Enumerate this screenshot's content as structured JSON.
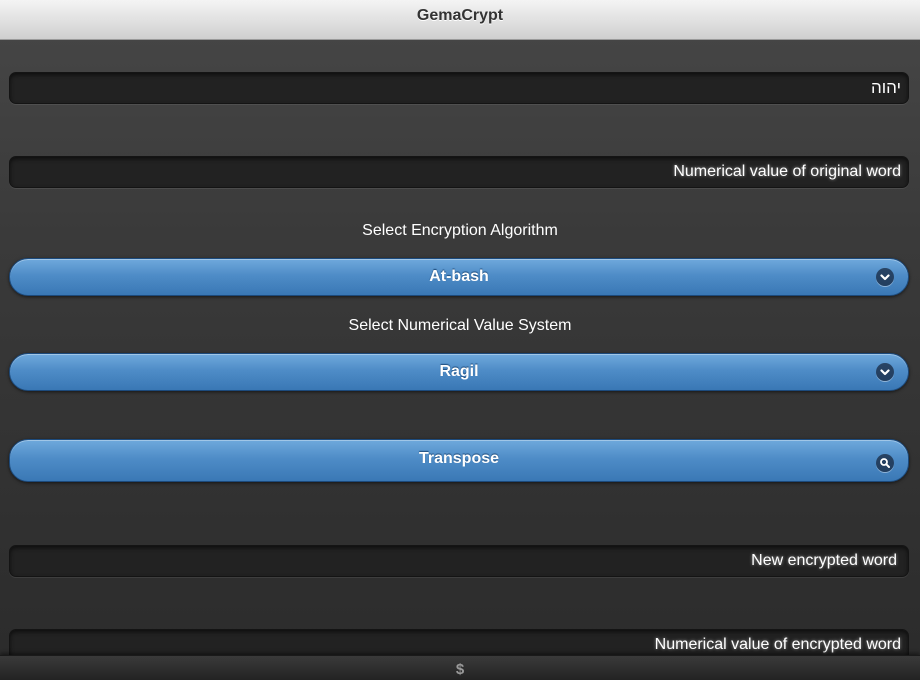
{
  "header": {
    "title": "GemaCrypt"
  },
  "original_word": {
    "value": "יהוה"
  },
  "original_numeric": {
    "placeholder": "Numerical value of original word"
  },
  "algorithm": {
    "label": "Select Encryption Algorithm",
    "selected": "At-bash",
    "icon": "chevron-down-icon"
  },
  "numeric_system": {
    "label": "Select Numerical Value System",
    "selected": "Ragil",
    "icon": "chevron-down-icon"
  },
  "transpose": {
    "label": "Transpose",
    "icon": "search-icon"
  },
  "encrypted_word": {
    "placeholder": "New encrypted word"
  },
  "encrypted_numeric": {
    "placeholder": "Numerical value of encrypted word"
  },
  "footer": {
    "symbol": "$"
  },
  "colors": {
    "accent": "#4e8cc7",
    "header": "#dedede",
    "background": "#333333",
    "field": "#222222"
  }
}
